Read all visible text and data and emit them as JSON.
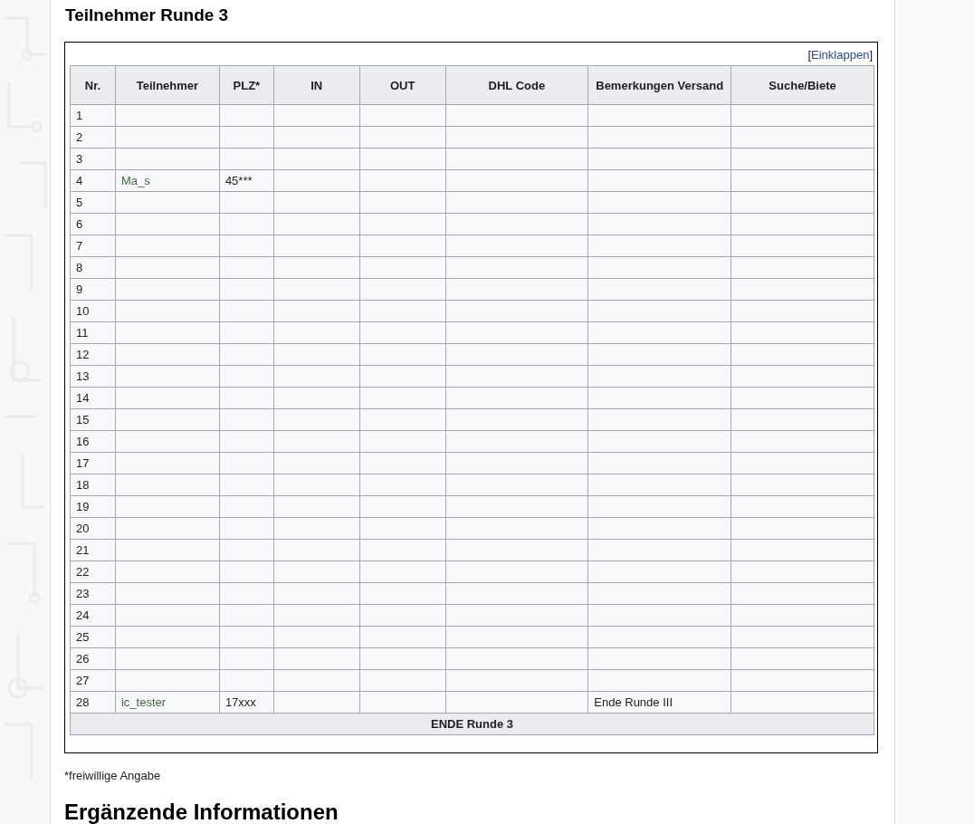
{
  "heading": "Teilnehmer Runde 3",
  "collapse": {
    "open": "[",
    "label": "Einklappen",
    "close": "]"
  },
  "table": {
    "columns": [
      {
        "label": "Nr."
      },
      {
        "label": "Teilnehmer"
      },
      {
        "label": "PLZ*"
      },
      {
        "label": "IN"
      },
      {
        "label": "OUT"
      },
      {
        "label": "DHL Code"
      },
      {
        "label": "Bemerkungen Versand"
      },
      {
        "label": "Suche/Biete"
      }
    ],
    "rows": [
      {
        "nr": "1"
      },
      {
        "nr": "2"
      },
      {
        "nr": "3"
      },
      {
        "nr": "4",
        "participant": "Ma_s",
        "plz": "45***"
      },
      {
        "nr": "5"
      },
      {
        "nr": "6"
      },
      {
        "nr": "7"
      },
      {
        "nr": "8"
      },
      {
        "nr": "9"
      },
      {
        "nr": "10"
      },
      {
        "nr": "11"
      },
      {
        "nr": "12"
      },
      {
        "nr": "13"
      },
      {
        "nr": "14"
      },
      {
        "nr": "15"
      },
      {
        "nr": "16"
      },
      {
        "nr": "17"
      },
      {
        "nr": "18"
      },
      {
        "nr": "19"
      },
      {
        "nr": "20"
      },
      {
        "nr": "21"
      },
      {
        "nr": "22"
      },
      {
        "nr": "23"
      },
      {
        "nr": "24"
      },
      {
        "nr": "25"
      },
      {
        "nr": "26"
      },
      {
        "nr": "27"
      },
      {
        "nr": "28",
        "participant": "ic_tester",
        "plz": "17xxx",
        "remarks": "Ende Runde III"
      }
    ],
    "footer": "ENDE Runde 3"
  },
  "footnote": "*freiwillige Angabe",
  "next_heading": "Ergänzende Informationen"
}
